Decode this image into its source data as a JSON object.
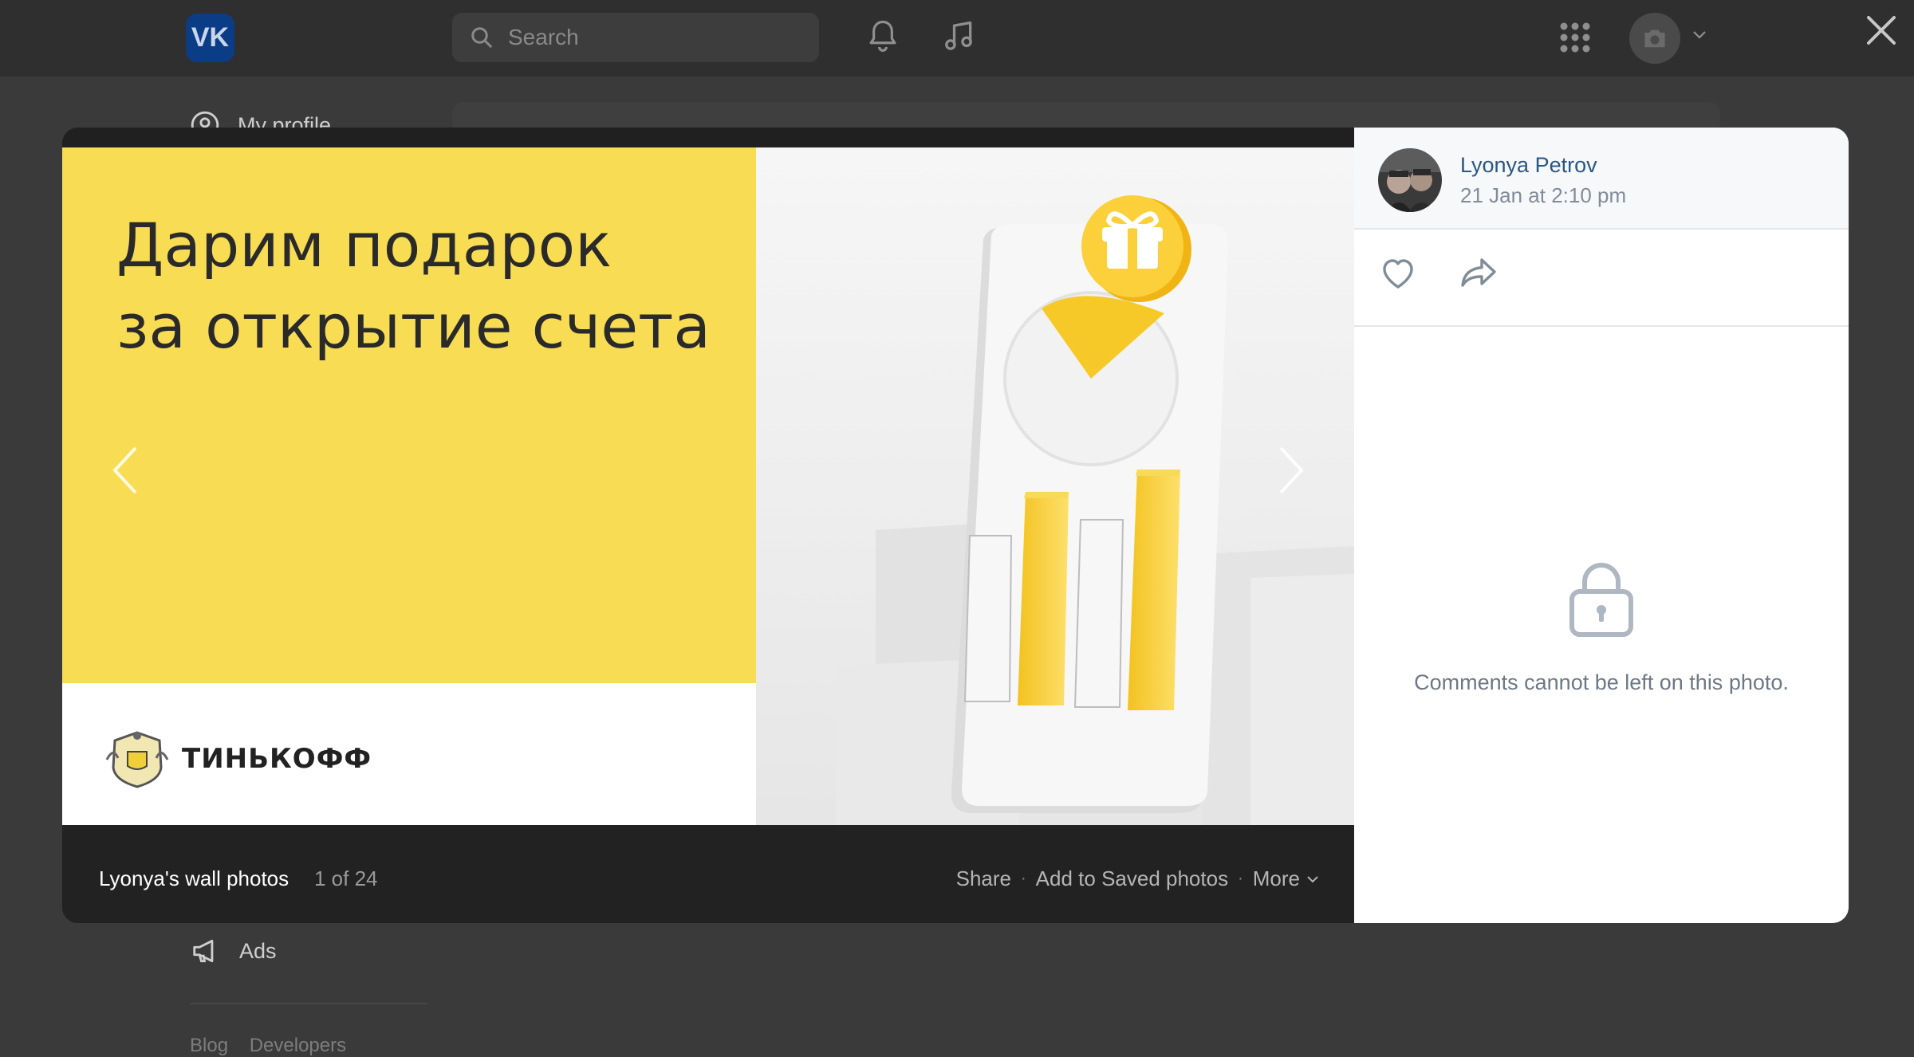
{
  "app": {
    "logo_text": "VK",
    "search": {
      "placeholder": "Search"
    },
    "sidebar": {
      "items": [
        {
          "label": "My profile"
        },
        {
          "label": "Ads"
        }
      ]
    },
    "footer_links": [
      "Blog",
      "Developers"
    ]
  },
  "viewer": {
    "photo": {
      "headline": [
        "Дарим подарок",
        "за открытие счета"
      ],
      "brand_name": "ТИНЬКОФФ",
      "colors": {
        "yellow": "#f8dc54",
        "right_bg": "#efefef"
      }
    },
    "footer": {
      "album_title": "Lyonya's wall photos",
      "counter": "1 of 24",
      "share_label": "Share",
      "save_label": "Add to Saved photos",
      "more_label": "More"
    },
    "side": {
      "author_name": "Lyonya Petrov",
      "date": "21 Jan at 2:10 pm",
      "comments_disabled_message": "Comments cannot be left on this photo."
    }
  }
}
